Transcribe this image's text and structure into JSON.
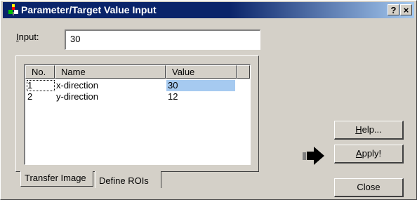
{
  "window": {
    "title": "Parameter/Target Value Input",
    "help_button": "?",
    "close_button": "×"
  },
  "input": {
    "label_first": "I",
    "label_rest": "nput:",
    "value": "30"
  },
  "table": {
    "columns": [
      "No.",
      "Name",
      "Value"
    ],
    "rows": [
      {
        "no": "1",
        "name": "x-direction",
        "value": "30",
        "selected": true
      },
      {
        "no": "2",
        "name": "y-direction",
        "value": "12",
        "selected": false
      }
    ]
  },
  "tabs": [
    "Transfer Image",
    "Define ROIs"
  ],
  "buttons": {
    "help_first": "H",
    "help_rest": "elp...",
    "apply_first": "A",
    "apply_rest": "pply!",
    "close": "Close"
  },
  "icons": {
    "title": "app-icon",
    "apply_arrow": "right-arrow-icon"
  },
  "colors": {
    "titlebar_start": "#0a246a",
    "titlebar_end": "#a6caf0",
    "selection": "#a6caf0",
    "face": "#d4d0c8"
  }
}
